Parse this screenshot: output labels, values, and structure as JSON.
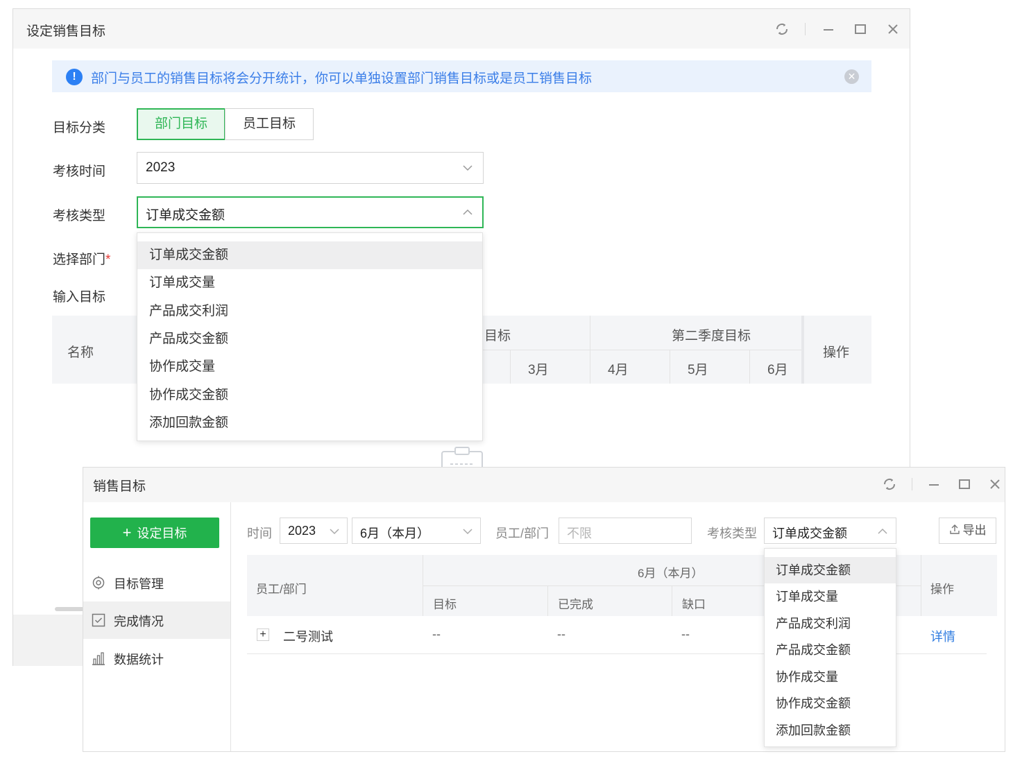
{
  "window1": {
    "title": "设定销售目标",
    "alert": "部门与员工的销售目标将会分开统计，你可以单独设置部门销售目标或是员工销售目标",
    "form": {
      "category_label": "目标分类",
      "category_options": [
        "部门目标",
        "员工目标"
      ],
      "category_selected": "部门目标",
      "time_label": "考核时间",
      "time_value": "2023",
      "type_label": "考核类型",
      "type_value": "订单成交金额",
      "dept_label": "选择部门",
      "dept_required_mark": "*",
      "input_label": "输入目标"
    },
    "table": {
      "name_header": "名称",
      "q1_header_partial": "目标",
      "q2_header": "第二季度目标",
      "months": [
        "3月",
        "4月",
        "5月",
        "6月"
      ],
      "action_header": "操作"
    },
    "dropdown_options": [
      "订单成交金额",
      "订单成交量",
      "产品成交利润",
      "产品成交金额",
      "协作成交量",
      "协作成交金额",
      "添加回款金额"
    ],
    "dropdown_selected": "订单成交金额"
  },
  "window2": {
    "title": "销售目标",
    "set_target_button": "设定目标",
    "sidebar": [
      {
        "label": "目标管理",
        "icon": "target-icon"
      },
      {
        "label": "完成情况",
        "icon": "checkbox-icon"
      },
      {
        "label": "数据统计",
        "icon": "bar-chart-icon"
      }
    ],
    "sidebar_active": "完成情况",
    "filters": {
      "time_label": "时间",
      "year_value": "2023",
      "month_value": "6月（本月）",
      "emp_label": "员工/部门",
      "emp_placeholder": "不限",
      "type_label": "考核类型",
      "type_value": "订单成交金额",
      "export_label": "导出"
    },
    "table": {
      "emp_header": "员工/部门",
      "month_header": "6月（本月）",
      "sub_headers": [
        "目标",
        "已完成",
        "缺口"
      ],
      "action_header": "操作",
      "rows": [
        {
          "expand": "+",
          "name": "二号测试",
          "target": "--",
          "done": "--",
          "gap": "--",
          "action": "详情"
        }
      ]
    },
    "dropdown_options": [
      "订单成交金额",
      "订单成交量",
      "产品成交利润",
      "产品成交金额",
      "协作成交量",
      "协作成交金额",
      "添加回款金额"
    ],
    "dropdown_selected": "订单成交金额"
  },
  "colors": {
    "accent_green": "#22b24c",
    "info_blue": "#2c80f4",
    "link_blue": "#2f7ce0",
    "required_red": "#e53935"
  }
}
